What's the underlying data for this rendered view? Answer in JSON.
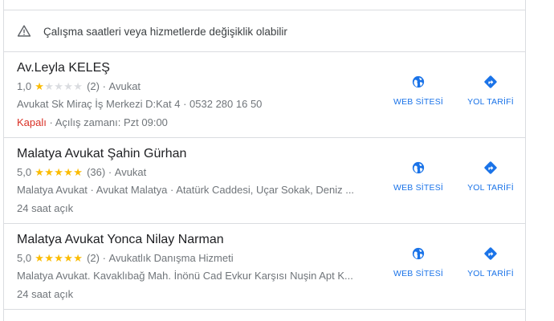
{
  "notice": {
    "icon": "warning-triangle-icon",
    "text": "Çalışma saatleri veya hizmetlerde değişiklik olabilir"
  },
  "listings": [
    {
      "name": "Av.Leyla KELEŞ",
      "rating": "1,0",
      "rating_value": 1,
      "reviews": "(2)",
      "category": "Avukat",
      "address": "Avukat Sk Miraç İş Merkezi D:Kat 4 · 0532 280 16 50",
      "status": "Kapalı",
      "hours": "Açılış zamanı: Pzt 09:00",
      "web_label": "WEB SİTESİ",
      "dir_label": "YOL TARİFİ"
    },
    {
      "name": "Malatya Avukat Şahin Gürhan",
      "rating": "5,0",
      "rating_value": 5,
      "reviews": "(36)",
      "category": "Avukat",
      "address": "Malatya Avukat · Avukat Malatya · Atatürk Caddesi, Uçar Sokak, Deniz ...",
      "status": "",
      "hours": "24 saat açık",
      "web_label": "WEB SİTESİ",
      "dir_label": "YOL TARİFİ"
    },
    {
      "name": "Malatya Avukat Yonca Nilay Narman",
      "rating": "5,0",
      "rating_value": 5,
      "reviews": "(2)",
      "category": "Avukatlık Danışma Hizmeti",
      "address": "Malatya Avukat. Kavaklıbağ Mah. İnönü Cad Evkur Karşısı Nuşin Apt K...",
      "status": "",
      "hours": "24 saat açık",
      "web_label": "WEB SİTESİ",
      "dir_label": "YOL TARİFİ"
    }
  ],
  "colors": {
    "link_blue": "#1a73e8",
    "star_gold": "#fbbc04",
    "closed_red": "#d93025",
    "secondary_text": "#70757a"
  }
}
